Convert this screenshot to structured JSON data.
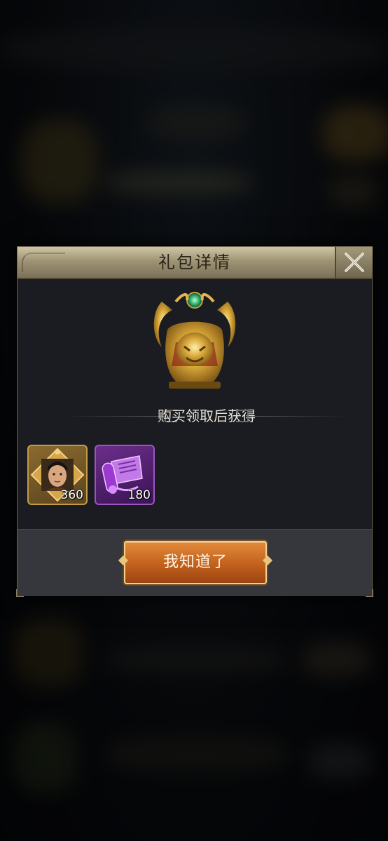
{
  "dialog": {
    "title": "礼包详情",
    "reward_heading": "购买领取后获得",
    "confirm_label": "我知道了"
  },
  "rewards": [
    {
      "icon": "general-portrait-icon",
      "quantity": "360",
      "frame_color": "#c49a46"
    },
    {
      "icon": "purple-scroll-icon",
      "quantity": "180",
      "frame_color": "#9a55c0"
    }
  ],
  "colors": {
    "header": "#9f9475",
    "button": "#c2611d",
    "panel": "#1a1c21"
  }
}
